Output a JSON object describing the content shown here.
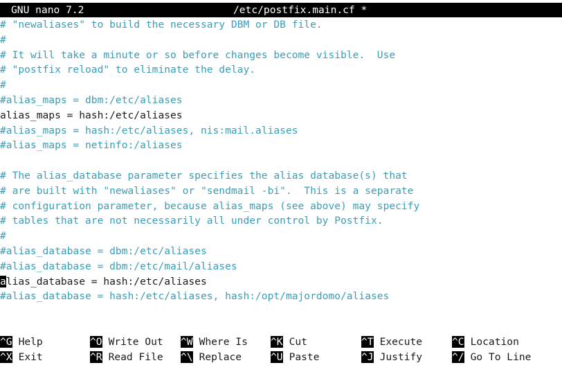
{
  "title_bar": {
    "version": "GNU nano 7.2",
    "filename": "/etc/postfix.main.cf *"
  },
  "lines": [
    {
      "text": "# \"newaliases\" to build the necessary DBM or DB file.",
      "kind": "comment"
    },
    {
      "text": "#",
      "kind": "comment"
    },
    {
      "text": "# It will take a minute or so before changes become visible.  Use",
      "kind": "comment"
    },
    {
      "text": "# \"postfix reload\" to eliminate the delay.",
      "kind": "comment"
    },
    {
      "text": "#",
      "kind": "comment"
    },
    {
      "text": "#alias_maps = dbm:/etc/aliases",
      "kind": "comment"
    },
    {
      "text": "alias_maps = hash:/etc/aliases",
      "kind": "code"
    },
    {
      "text": "#alias_maps = hash:/etc/aliases, nis:mail.aliases",
      "kind": "comment"
    },
    {
      "text": "#alias_maps = netinfo:/aliases",
      "kind": "comment"
    },
    {
      "text": "",
      "kind": "comment"
    },
    {
      "text": "# The alias_database parameter specifies the alias database(s) that",
      "kind": "comment"
    },
    {
      "text": "# are built with \"newaliases\" or \"sendmail -bi\".  This is a separate",
      "kind": "comment"
    },
    {
      "text": "# configuration parameter, because alias_maps (see above) may specify",
      "kind": "comment"
    },
    {
      "text": "# tables that are not necessarily all under control by Postfix.",
      "kind": "comment"
    },
    {
      "text": "#",
      "kind": "comment"
    },
    {
      "text": "#alias_database = dbm:/etc/aliases",
      "kind": "comment"
    },
    {
      "text": "#alias_database = dbm:/etc/mail/aliases",
      "kind": "comment"
    },
    {
      "text": "alias_database = hash:/etc/aliases",
      "kind": "code",
      "cursor": true
    },
    {
      "text": "#alias_database = hash:/etc/aliases, hash:/opt/majordomo/aliases",
      "kind": "comment"
    }
  ],
  "shortcuts": {
    "row1": [
      {
        "key": "^G",
        "label": "Help"
      },
      {
        "key": "^O",
        "label": "Write Out"
      },
      {
        "key": "^W",
        "label": "Where Is"
      },
      {
        "key": "^K",
        "label": "Cut"
      },
      {
        "key": "^T",
        "label": "Execute"
      },
      {
        "key": "^C",
        "label": "Location"
      }
    ],
    "row2": [
      {
        "key": "^X",
        "label": "Exit"
      },
      {
        "key": "^R",
        "label": "Read File"
      },
      {
        "key": "^\\",
        "label": "Replace"
      },
      {
        "key": "^U",
        "label": "Paste"
      },
      {
        "key": "^J",
        "label": "Justify"
      },
      {
        "key": "^/",
        "label": "Go To Line"
      }
    ]
  },
  "colors": {
    "comment": "#3a9db8",
    "code": "#1a1a1a",
    "bar_background": "#000000",
    "bar_text": "#ffffff"
  }
}
